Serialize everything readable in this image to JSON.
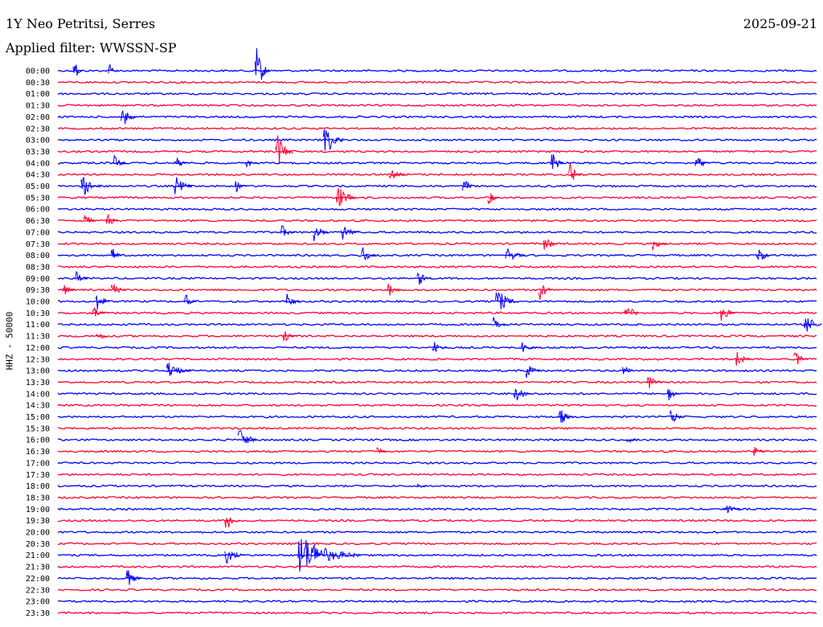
{
  "header": {
    "station": "1Y Neo Petritsi, Serres",
    "date": "2025-09-21",
    "filter": "Applied filter: WWSSN-SP"
  },
  "chart_data": {
    "type": "line",
    "title": "1Y Neo Petritsi, Serres",
    "ylabel": "HHZ - 50000",
    "row_labels": [
      "00:00",
      "00:30",
      "01:00",
      "01:30",
      "02:00",
      "02:30",
      "03:00",
      "03:30",
      "04:00",
      "04:30",
      "05:00",
      "05:30",
      "06:00",
      "06:30",
      "07:00",
      "07:30",
      "08:00",
      "08:30",
      "09:00",
      "09:30",
      "10:00",
      "10:30",
      "11:00",
      "11:30",
      "12:00",
      "12:30",
      "13:00",
      "13:30",
      "14:00",
      "14:30",
      "15:00",
      "15:30",
      "16:00",
      "16:30",
      "17:00",
      "17:30",
      "18:00",
      "18:30",
      "19:00",
      "19:30",
      "20:00",
      "20:30",
      "21:00",
      "21:30",
      "22:00",
      "22:30",
      "23:00",
      "23:30"
    ],
    "series_colors": [
      "#0000ff",
      "#ff0033"
    ],
    "x_minutes_range": [
      0,
      30
    ],
    "events": [
      {
        "row": "00:00",
        "minute": 0.6,
        "amplitude": 20,
        "duration": 0.4
      },
      {
        "row": "00:00",
        "minute": 2.0,
        "amplitude": 12,
        "duration": 0.4
      },
      {
        "row": "00:00",
        "minute": 7.8,
        "amplitude": 40,
        "duration": 0.6
      },
      {
        "row": "02:00",
        "minute": 2.5,
        "amplitude": 20,
        "duration": 0.6
      },
      {
        "row": "03:00",
        "minute": 10.5,
        "amplitude": 30,
        "duration": 0.8
      },
      {
        "row": "03:30",
        "minute": 8.6,
        "amplitude": 30,
        "duration": 0.7
      },
      {
        "row": "04:00",
        "minute": 2.2,
        "amplitude": 14,
        "duration": 0.5
      },
      {
        "row": "04:00",
        "minute": 4.6,
        "amplitude": 14,
        "duration": 0.6
      },
      {
        "row": "04:00",
        "minute": 7.4,
        "amplitude": 10,
        "duration": 0.5
      },
      {
        "row": "04:00",
        "minute": 19.5,
        "amplitude": 20,
        "duration": 0.5
      },
      {
        "row": "04:00",
        "minute": 25.2,
        "amplitude": 14,
        "duration": 0.6
      },
      {
        "row": "04:30",
        "minute": 13.1,
        "amplitude": 10,
        "duration": 0.8
      },
      {
        "row": "04:30",
        "minute": 20.2,
        "amplitude": 22,
        "duration": 0.5
      },
      {
        "row": "05:00",
        "minute": 0.9,
        "amplitude": 20,
        "duration": 0.8
      },
      {
        "row": "05:00",
        "minute": 4.6,
        "amplitude": 20,
        "duration": 0.7
      },
      {
        "row": "05:00",
        "minute": 7.0,
        "amplitude": 10,
        "duration": 0.5
      },
      {
        "row": "05:00",
        "minute": 16.0,
        "amplitude": 20,
        "duration": 0.4
      },
      {
        "row": "05:30",
        "minute": 11.0,
        "amplitude": 22,
        "duration": 0.8
      },
      {
        "row": "05:30",
        "minute": 17.0,
        "amplitude": 12,
        "duration": 0.5
      },
      {
        "row": "06:30",
        "minute": 1.0,
        "amplitude": 18,
        "duration": 0.5
      },
      {
        "row": "06:30",
        "minute": 1.9,
        "amplitude": 14,
        "duration": 0.5
      },
      {
        "row": "07:00",
        "minute": 8.8,
        "amplitude": 12,
        "duration": 0.6
      },
      {
        "row": "07:00",
        "minute": 10.1,
        "amplitude": 18,
        "duration": 0.6
      },
      {
        "row": "07:00",
        "minute": 11.2,
        "amplitude": 14,
        "duration": 0.7
      },
      {
        "row": "07:30",
        "minute": 19.2,
        "amplitude": 16,
        "duration": 0.6
      },
      {
        "row": "07:30",
        "minute": 23.5,
        "amplitude": 14,
        "duration": 0.6
      },
      {
        "row": "08:00",
        "minute": 2.1,
        "amplitude": 14,
        "duration": 0.5
      },
      {
        "row": "08:00",
        "minute": 12.0,
        "amplitude": 14,
        "duration": 0.6
      },
      {
        "row": "08:00",
        "minute": 17.7,
        "amplitude": 14,
        "duration": 0.8
      },
      {
        "row": "08:00",
        "minute": 27.6,
        "amplitude": 18,
        "duration": 0.6
      },
      {
        "row": "09:00",
        "minute": 0.7,
        "amplitude": 14,
        "duration": 0.5
      },
      {
        "row": "09:00",
        "minute": 14.2,
        "amplitude": 14,
        "duration": 0.6
      },
      {
        "row": "09:30",
        "minute": 0.2,
        "amplitude": 12,
        "duration": 0.5
      },
      {
        "row": "09:30",
        "minute": 2.1,
        "amplitude": 14,
        "duration": 0.6
      },
      {
        "row": "09:30",
        "minute": 13.0,
        "amplitude": 14,
        "duration": 0.6
      },
      {
        "row": "09:30",
        "minute": 19.0,
        "amplitude": 18,
        "duration": 0.6
      },
      {
        "row": "10:00",
        "minute": 1.5,
        "amplitude": 18,
        "duration": 0.6
      },
      {
        "row": "10:00",
        "minute": 5.0,
        "amplitude": 14,
        "duration": 0.5
      },
      {
        "row": "10:00",
        "minute": 9.0,
        "amplitude": 14,
        "duration": 0.6
      },
      {
        "row": "10:00",
        "minute": 17.3,
        "amplitude": 22,
        "duration": 0.9
      },
      {
        "row": "10:30",
        "minute": 1.3,
        "amplitude": 16,
        "duration": 0.6
      },
      {
        "row": "10:30",
        "minute": 22.4,
        "amplitude": 20,
        "duration": 0.6
      },
      {
        "row": "10:30",
        "minute": 26.2,
        "amplitude": 16,
        "duration": 0.6
      },
      {
        "row": "11:00",
        "minute": 17.2,
        "amplitude": 14,
        "duration": 0.6
      },
      {
        "row": "11:00",
        "minute": 29.5,
        "amplitude": 22,
        "duration": 0.7
      },
      {
        "row": "11:30",
        "minute": 1.5,
        "amplitude": 14,
        "duration": 0.5
      },
      {
        "row": "11:30",
        "minute": 8.9,
        "amplitude": 10,
        "duration": 0.6
      },
      {
        "row": "12:00",
        "minute": 14.8,
        "amplitude": 12,
        "duration": 0.6
      },
      {
        "row": "12:00",
        "minute": 18.3,
        "amplitude": 12,
        "duration": 0.6
      },
      {
        "row": "12:30",
        "minute": 26.8,
        "amplitude": 14,
        "duration": 0.6
      },
      {
        "row": "12:30",
        "minute": 29.1,
        "amplitude": 16,
        "duration": 0.6
      },
      {
        "row": "13:00",
        "minute": 4.3,
        "amplitude": 14,
        "duration": 1.0
      },
      {
        "row": "13:00",
        "minute": 18.5,
        "amplitude": 14,
        "duration": 0.6
      },
      {
        "row": "13:00",
        "minute": 22.3,
        "amplitude": 14,
        "duration": 0.5
      },
      {
        "row": "13:30",
        "minute": 23.3,
        "amplitude": 14,
        "duration": 0.6
      },
      {
        "row": "14:00",
        "minute": 18.0,
        "amplitude": 18,
        "duration": 0.7
      },
      {
        "row": "14:00",
        "minute": 24.1,
        "amplitude": 14,
        "duration": 0.5
      },
      {
        "row": "15:00",
        "minute": 19.8,
        "amplitude": 16,
        "duration": 0.6
      },
      {
        "row": "15:00",
        "minute": 24.2,
        "amplitude": 14,
        "duration": 0.6
      },
      {
        "row": "16:00",
        "minute": 7.1,
        "amplitude": 22,
        "duration": 0.8
      },
      {
        "row": "16:00",
        "minute": 22.5,
        "amplitude": 8,
        "duration": 0.4
      },
      {
        "row": "16:30",
        "minute": 12.6,
        "amplitude": 12,
        "duration": 0.4
      },
      {
        "row": "16:30",
        "minute": 27.5,
        "amplitude": 8,
        "duration": 0.6
      },
      {
        "row": "18:00",
        "minute": 14.2,
        "amplitude": 5,
        "duration": 0.4
      },
      {
        "row": "19:00",
        "minute": 26.3,
        "amplitude": 10,
        "duration": 0.8
      },
      {
        "row": "19:30",
        "minute": 6.6,
        "amplitude": 22,
        "duration": 0.6
      },
      {
        "row": "21:00",
        "minute": 6.6,
        "amplitude": 16,
        "duration": 0.8
      },
      {
        "row": "21:00",
        "minute": 9.5,
        "amplitude": 30,
        "duration": 2.5
      },
      {
        "row": "22:00",
        "minute": 2.7,
        "amplitude": 16,
        "duration": 0.6
      }
    ]
  }
}
